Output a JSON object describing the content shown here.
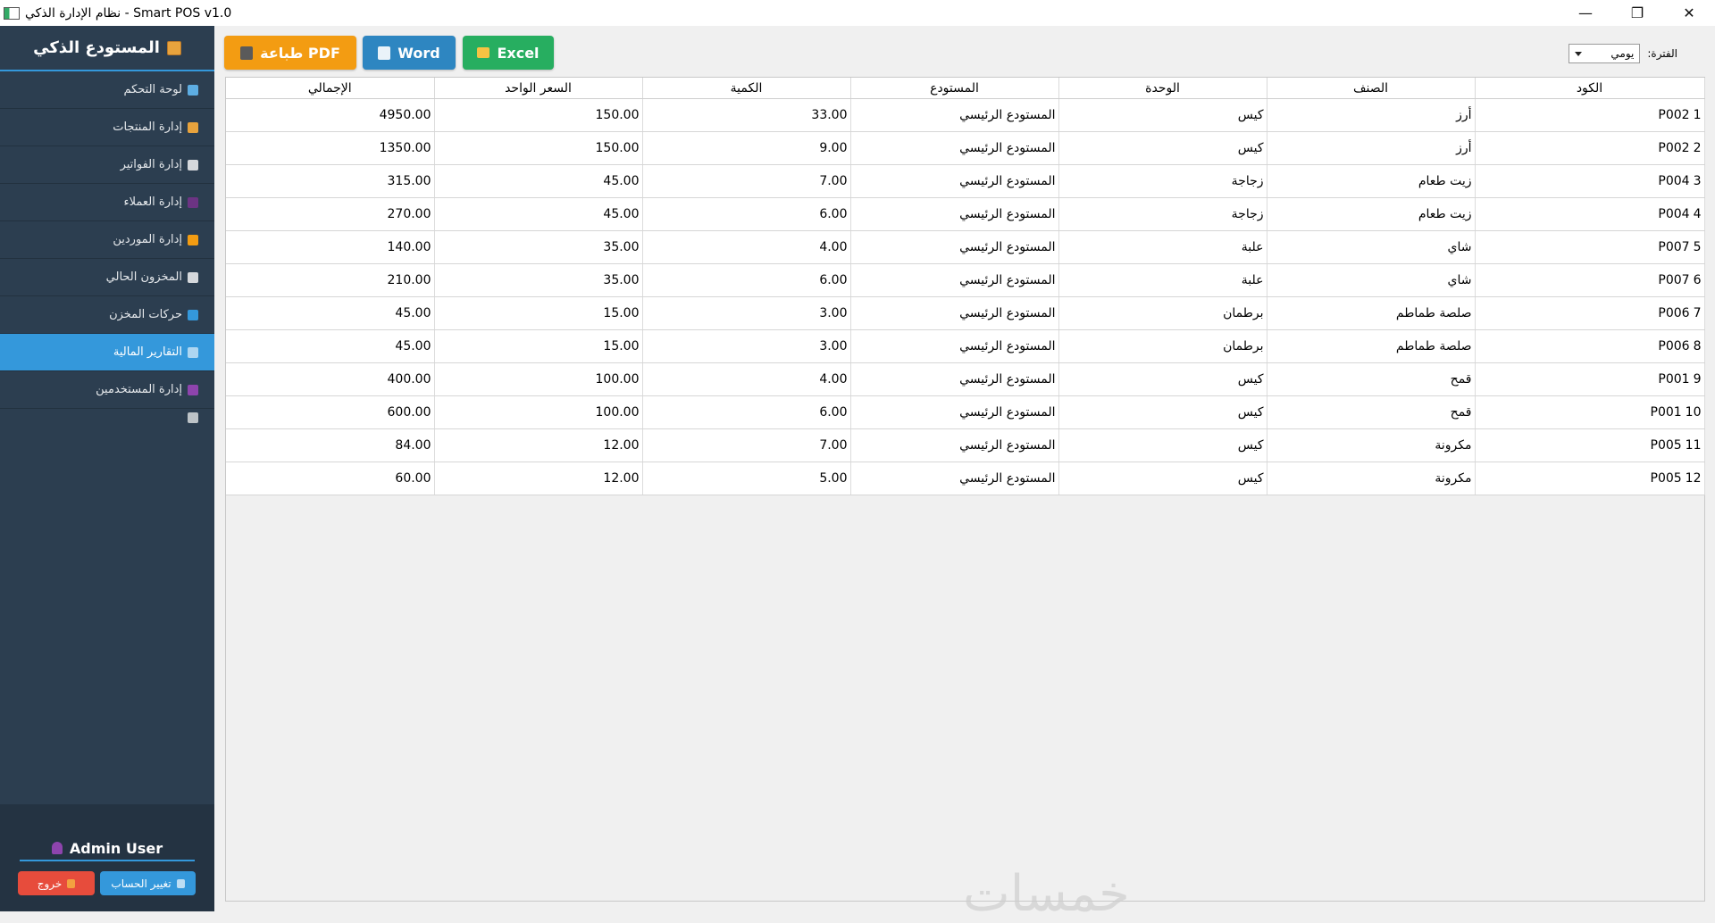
{
  "window": {
    "title": "نظام الإدارة الذكي - Smart POS v1.0",
    "minimize": "—",
    "restore": "❐",
    "close": "✕"
  },
  "sidebar": {
    "brand": "المستودع الذكي",
    "items": [
      {
        "label": "لوحة التحكم",
        "icon": "chart-icon",
        "color": "#5dade2"
      },
      {
        "label": "إدارة المنتجات",
        "icon": "box-icon",
        "color": "#e8a33d"
      },
      {
        "label": "إدارة الفواتير",
        "icon": "invoice-icon",
        "color": "#d5d8dc"
      },
      {
        "label": "إدارة العملاء",
        "icon": "customers-icon",
        "color": "#6c3483"
      },
      {
        "label": "إدارة الموردين",
        "icon": "truck-icon",
        "color": "#f39c12"
      },
      {
        "label": "المخزون الحالي",
        "icon": "clipboard-icon",
        "color": "#d5d8dc"
      },
      {
        "label": "حركات المخزن",
        "icon": "refresh-icon",
        "color": "#3498db"
      },
      {
        "label": "التقارير المالية",
        "icon": "trend-icon",
        "color": "#aed6f1"
      },
      {
        "label": "إدارة المستخدمين",
        "icon": "user-icon",
        "color": "#8e44ad"
      }
    ],
    "active_index": 7,
    "user_name": "Admin User",
    "switch_label": "تغيير الحساب",
    "logout_label": "خروج"
  },
  "toolbar": {
    "pdf_label": "طباعة PDF",
    "word_label": "Word",
    "excel_label": "Excel",
    "period_label": "الفترة:",
    "period_value": "يومي"
  },
  "table": {
    "columns": [
      "الكود",
      "الصنف",
      "الوحدة",
      "المستودع",
      "الكمية",
      "السعر الواحد",
      "الإجمالي"
    ],
    "rows": [
      {
        "n": "1",
        "code": "P002",
        "item": "أرز",
        "unit": "كيس",
        "warehouse": "المستودع الرئيسي",
        "qty": "33.00",
        "price": "150.00",
        "total": "4950.00"
      },
      {
        "n": "2",
        "code": "P002",
        "item": "أرز",
        "unit": "كيس",
        "warehouse": "المستودع الرئيسي",
        "qty": "9.00",
        "price": "150.00",
        "total": "1350.00"
      },
      {
        "n": "3",
        "code": "P004",
        "item": "زيت طعام",
        "unit": "زجاجة",
        "warehouse": "المستودع الرئيسي",
        "qty": "7.00",
        "price": "45.00",
        "total": "315.00"
      },
      {
        "n": "4",
        "code": "P004",
        "item": "زيت طعام",
        "unit": "زجاجة",
        "warehouse": "المستودع الرئيسي",
        "qty": "6.00",
        "price": "45.00",
        "total": "270.00"
      },
      {
        "n": "5",
        "code": "P007",
        "item": "شاي",
        "unit": "علبة",
        "warehouse": "المستودع الرئيسي",
        "qty": "4.00",
        "price": "35.00",
        "total": "140.00"
      },
      {
        "n": "6",
        "code": "P007",
        "item": "شاي",
        "unit": "علبة",
        "warehouse": "المستودع الرئيسي",
        "qty": "6.00",
        "price": "35.00",
        "total": "210.00"
      },
      {
        "n": "7",
        "code": "P006",
        "item": "صلصة طماطم",
        "unit": "برطمان",
        "warehouse": "المستودع الرئيسي",
        "qty": "3.00",
        "price": "15.00",
        "total": "45.00"
      },
      {
        "n": "8",
        "code": "P006",
        "item": "صلصة طماطم",
        "unit": "برطمان",
        "warehouse": "المستودع الرئيسي",
        "qty": "3.00",
        "price": "15.00",
        "total": "45.00"
      },
      {
        "n": "9",
        "code": "P001",
        "item": "قمح",
        "unit": "كيس",
        "warehouse": "المستودع الرئيسي",
        "qty": "4.00",
        "price": "100.00",
        "total": "400.00"
      },
      {
        "n": "10",
        "code": "P001",
        "item": "قمح",
        "unit": "كيس",
        "warehouse": "المستودع الرئيسي",
        "qty": "6.00",
        "price": "100.00",
        "total": "600.00"
      },
      {
        "n": "11",
        "code": "P005",
        "item": "مكرونة",
        "unit": "كيس",
        "warehouse": "المستودع الرئيسي",
        "qty": "7.00",
        "price": "12.00",
        "total": "84.00"
      },
      {
        "n": "12",
        "code": "P005",
        "item": "مكرونة",
        "unit": "كيس",
        "warehouse": "المستودع الرئيسي",
        "qty": "5.00",
        "price": "12.00",
        "total": "60.00"
      }
    ]
  },
  "watermark": "خمسات"
}
